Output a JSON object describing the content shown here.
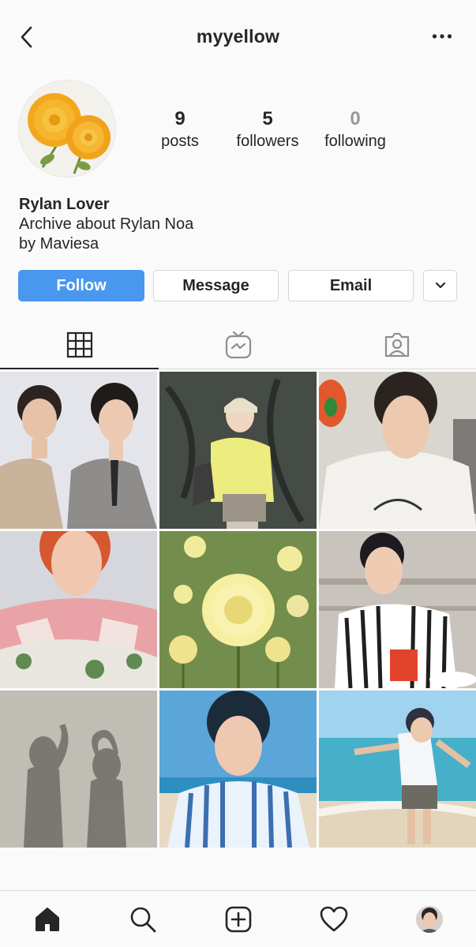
{
  "header": {
    "username": "myyellow",
    "back_icon": "chevron-left-icon",
    "more_icon": "ellipsis-icon"
  },
  "profile": {
    "avatar": "yellow-flower-photo",
    "stats": [
      {
        "value": "9",
        "label": "posts"
      },
      {
        "value": "5",
        "label": "followers"
      },
      {
        "value": "0",
        "label": "following"
      }
    ],
    "name": "Rylan Lover",
    "bio_lines": [
      "Archive about Rylan Noa",
      "by Maviesa"
    ]
  },
  "actions": {
    "follow_label": "Follow",
    "message_label": "Message",
    "email_label": "Email",
    "more_icon": "chevron-down-icon"
  },
  "tabs": [
    {
      "name": "grid",
      "icon": "grid-icon",
      "active": true
    },
    {
      "name": "igtv",
      "icon": "igtv-icon",
      "active": false
    },
    {
      "name": "tagged",
      "icon": "tagged-user-icon",
      "active": false
    }
  ],
  "posts": [
    {
      "id": 1,
      "subject": "two men in suits"
    },
    {
      "id": 2,
      "subject": "man in yellow cap and hoodie"
    },
    {
      "id": 3,
      "subject": "man in white t-shirt selfie"
    },
    {
      "id": 4,
      "subject": "man with red hair and flowers"
    },
    {
      "id": 5,
      "subject": "yellow flowers"
    },
    {
      "id": 6,
      "subject": "man eating in striped shirt"
    },
    {
      "id": 7,
      "subject": "shadows making heart"
    },
    {
      "id": 8,
      "subject": "man in striped shirt by sea"
    },
    {
      "id": 9,
      "subject": "man on beach"
    }
  ],
  "bottom_nav": [
    {
      "name": "home",
      "icon": "home-icon"
    },
    {
      "name": "search",
      "icon": "search-icon"
    },
    {
      "name": "new-post",
      "icon": "plus-square-icon"
    },
    {
      "name": "activity",
      "icon": "heart-icon"
    },
    {
      "name": "profile",
      "icon": "profile-avatar"
    }
  ],
  "colors": {
    "accent": "#4a97f0",
    "text": "#262626",
    "muted": "#999999",
    "border": "#dbdbdb",
    "background": "#fafafa"
  }
}
